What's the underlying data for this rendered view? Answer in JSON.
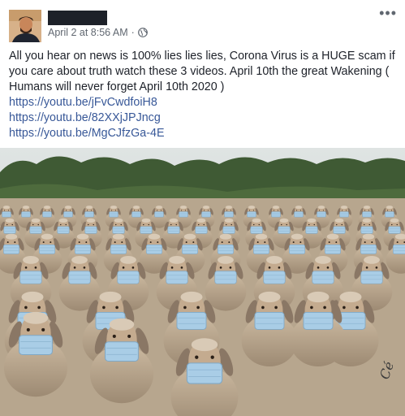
{
  "post": {
    "author_redacted": true,
    "timestamp": "April 2 at 8:56 AM",
    "separator": "·",
    "privacy_icon": "globe-icon",
    "more_icon": "more-horizontal-icon",
    "body": "All you hear on news is 100% lies lies lies, Corona Virus is a HUGE scam if you care about truth watch these 3 videos. April 10th the great Wakening ( Humans will never forget April 10th 2020 )",
    "links": [
      "https://youtu.be/jFvCwdfoiH8",
      "https://youtu.be/82XXjJPJncg",
      "https://youtu.be/MgCJfzGa-4E"
    ],
    "image": {
      "subject": "flock-of-sheep-wearing-surgical-masks",
      "signature": "Cé"
    }
  },
  "colors": {
    "text": "#1d2129",
    "meta": "#606770",
    "link": "#385898",
    "mask": "#a9cde6"
  }
}
